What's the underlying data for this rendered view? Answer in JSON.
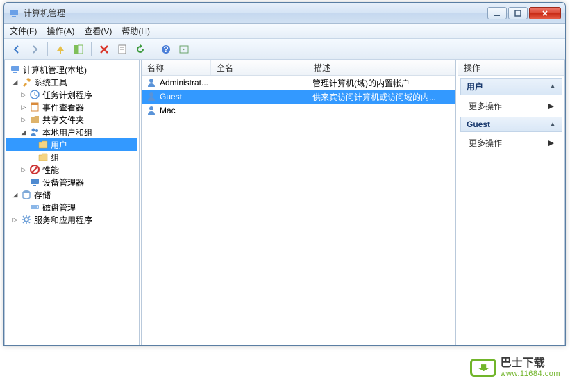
{
  "titlebar": {
    "title": "计算机管理"
  },
  "menu": {
    "file": "文件(F)",
    "action": "操作(A)",
    "view": "查看(V)",
    "help": "帮助(H)"
  },
  "tree": {
    "root": "计算机管理(本地)",
    "system_tools": "系统工具",
    "task_sched": "任务计划程序",
    "event_viewer": "事件查看器",
    "shared_folders": "共享文件夹",
    "local_users": "本地用户和组",
    "users": "用户",
    "groups": "组",
    "performance": "性能",
    "device_mgr": "设备管理器",
    "storage": "存储",
    "disk_mgmt": "磁盘管理",
    "services_apps": "服务和应用程序"
  },
  "list": {
    "col_name": "名称",
    "col_fullname": "全名",
    "col_desc": "描述",
    "rows": [
      {
        "name": "Administrat...",
        "fullname": "",
        "desc": "管理计算机(域)的内置帐户",
        "selected": false
      },
      {
        "name": "Guest",
        "fullname": "",
        "desc": "供来宾访问计算机或访问域的内...",
        "selected": true
      },
      {
        "name": "Mac",
        "fullname": "",
        "desc": "",
        "selected": false
      }
    ]
  },
  "actions": {
    "header": "操作",
    "sect1": "用户",
    "more": "更多操作",
    "sect2": "Guest"
  },
  "watermark": {
    "cn": "巴士下载",
    "url": "www.11684.com"
  }
}
